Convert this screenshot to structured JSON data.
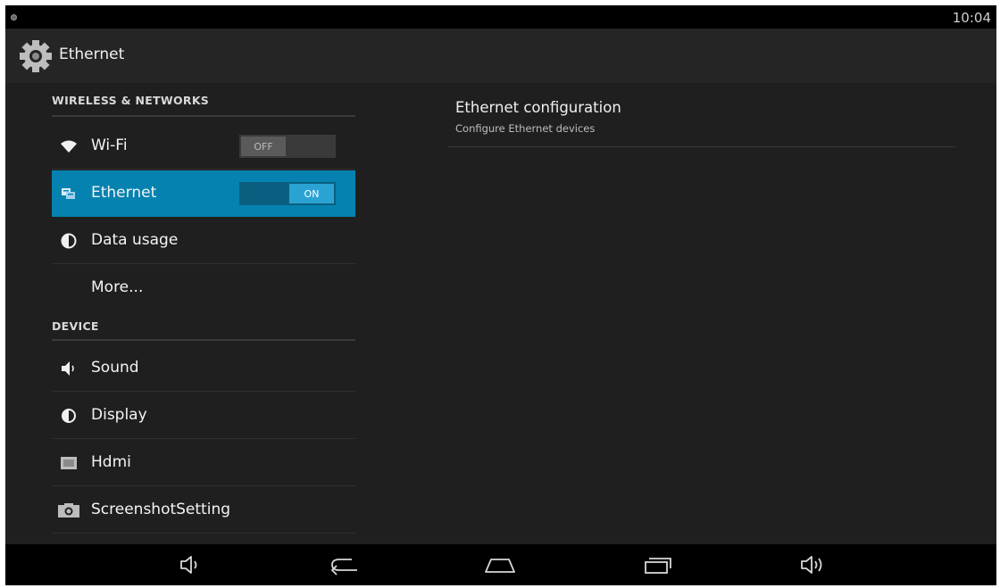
{
  "status_bar": {
    "time": "10:04"
  },
  "action_bar": {
    "title": "Ethernet",
    "icon": "settings-gear-icon"
  },
  "sections": [
    {
      "header": "WIRELESS & NETWORKS",
      "items": [
        {
          "label": "Wi-Fi",
          "icon": "wifi-icon",
          "toggle": "OFF"
        },
        {
          "label": "Ethernet",
          "icon": "ethernet-icon",
          "toggle": "ON",
          "selected": true
        },
        {
          "label": "Data usage",
          "icon": "data-usage-icon"
        },
        {
          "label": "More..."
        }
      ]
    },
    {
      "header": "DEVICE",
      "items": [
        {
          "label": "Sound",
          "icon": "sound-icon"
        },
        {
          "label": "Display",
          "icon": "display-icon"
        },
        {
          "label": "Hdmi",
          "icon": "hdmi-icon"
        },
        {
          "label": "ScreenshotSetting",
          "icon": "camera-icon"
        }
      ]
    }
  ],
  "detail": {
    "title": "Ethernet configuration",
    "summary": "Configure Ethernet devices"
  },
  "nav_bar": {
    "buttons": [
      "volume-down-icon",
      "back-icon",
      "home-icon",
      "recents-icon",
      "volume-up-icon"
    ]
  },
  "colors": {
    "accent": "#0582b0",
    "toggle_on": "#2aa3d3",
    "background": "#1f1f1f"
  }
}
